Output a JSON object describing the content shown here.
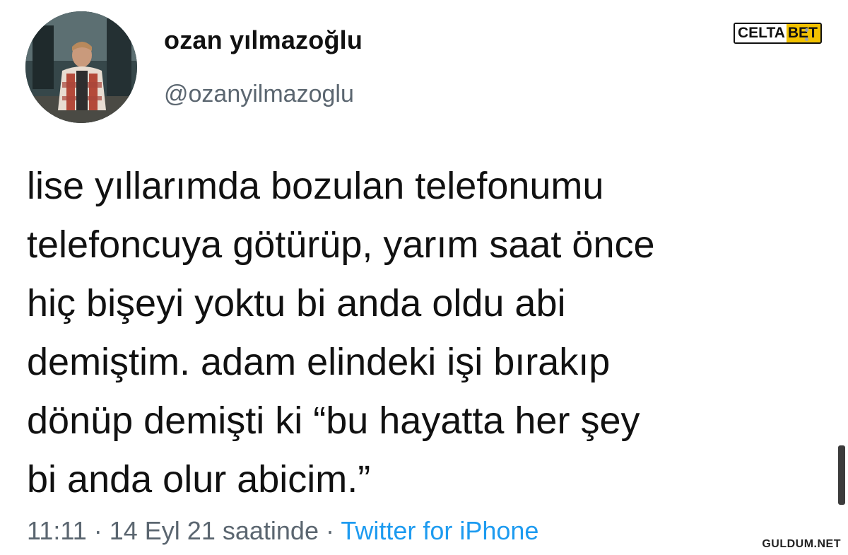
{
  "user": {
    "display_name": "ozan yılmazoğlu",
    "handle": "@ozanyilmazoglu"
  },
  "tweet": {
    "lines": [
      "lise yıllarımda bozulan telefonumu",
      "telefoncuya götürüp, yarım saat önce",
      "hiç bişeyi yoktu bi anda oldu abi",
      "demiştim. adam elindeki işi bırakıp",
      "dönüp demişti ki “bu hayatta her şey",
      "bi anda olur abicim.”"
    ]
  },
  "meta": {
    "time": "11:11",
    "separator1": " · ",
    "date": "14 Eyl 21 saatinde",
    "separator2": " · ",
    "source": "Twitter for iPhone",
    "source_color": "#1d9bf0"
  },
  "overlays": {
    "brand_logo_part1": "CELTA",
    "brand_logo_part2": "BET",
    "watermark": "GULDUM.NET"
  },
  "icons": {
    "avatar": "profile-photo",
    "more": "more-icon"
  }
}
